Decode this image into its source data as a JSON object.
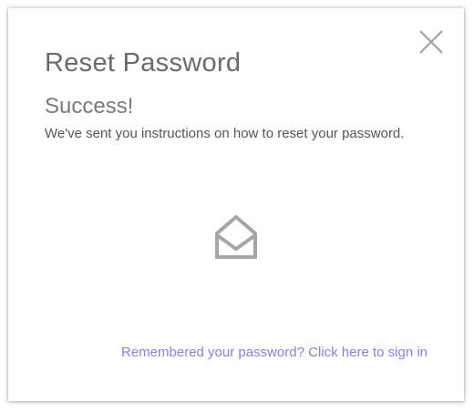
{
  "modal": {
    "title": "Reset Password",
    "status": "Success!",
    "message": "We've sent you instructions on how to reset your password.",
    "icon": "envelope-open-icon",
    "close_icon": "close-icon",
    "signin_link": "Remembered your password? Click here to sign in"
  },
  "colors": {
    "link": "#8c7fd9",
    "title": "#6a6a6a",
    "icon": "#a6a6a6"
  }
}
